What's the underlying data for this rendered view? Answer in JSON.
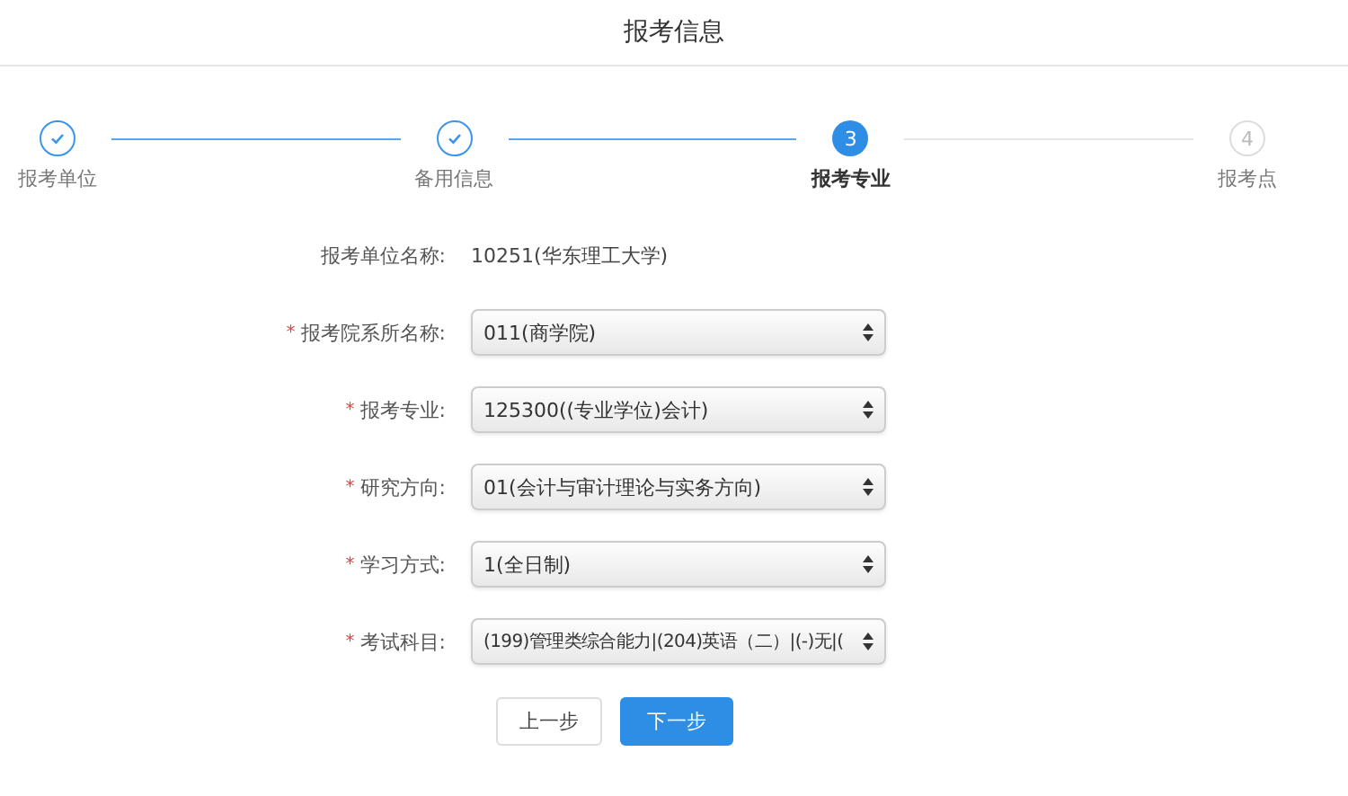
{
  "title": "报考信息",
  "steps": [
    {
      "kind": "done",
      "label": "报考单位"
    },
    {
      "kind": "done",
      "label": "备用信息"
    },
    {
      "kind": "current",
      "number": "3",
      "label": "报考专业"
    },
    {
      "kind": "todo",
      "number": "4",
      "label": "报考点"
    }
  ],
  "info": {
    "label": "报考单位名称:",
    "value": "10251(华东理工大学)"
  },
  "fields": [
    {
      "mark": "*",
      "label": "报考院系所名称:",
      "value": "011(商学院)"
    },
    {
      "mark": "*",
      "label": "报考专业:",
      "value": "125300((专业学位)会计)"
    },
    {
      "mark": "*",
      "label": "研究方向:",
      "value": "01(会计与审计理论与实务方向)"
    },
    {
      "mark": "*",
      "label": "学习方式:",
      "value": "1(全日制)"
    },
    {
      "mark": "*",
      "label": "考试科目:",
      "value": "(199)管理类综合能力|(204)英语（二）|(-)无|("
    }
  ],
  "buttons": [
    {
      "kind": "secondary",
      "label": "上一步"
    },
    {
      "kind": "primary",
      "label": "下一步"
    }
  ]
}
